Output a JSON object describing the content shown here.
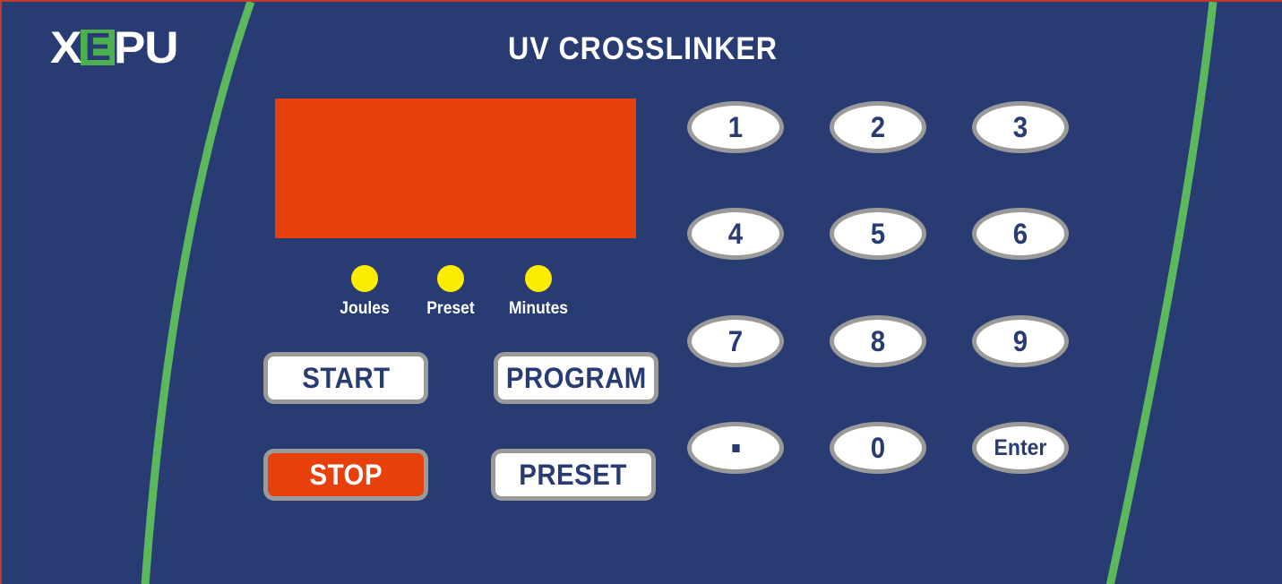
{
  "device": {
    "title": "UV CROSSLINKER",
    "brand": {
      "part1": "X",
      "highlight": "E",
      "part2": "PU"
    },
    "colors": {
      "panel_bg": "#283C73",
      "accent_green": "#4CAF50",
      "display_orange": "#E8400A",
      "led_yellow": "#FBEC00",
      "button_white": "#FFFFFF",
      "button_border_gray": "#9A9A99",
      "text_navy": "#283C73",
      "edge_red": "#C0392B"
    }
  },
  "display": {
    "value": "",
    "name": "display-panel"
  },
  "indicators": [
    {
      "label": "Joules",
      "icon": "led-indicator",
      "lit": true
    },
    {
      "label": "Preset",
      "icon": "led-indicator",
      "lit": true
    },
    {
      "label": "Minutes",
      "icon": "led-indicator",
      "lit": true
    }
  ],
  "action_buttons": [
    {
      "label": "START",
      "style": "light"
    },
    {
      "label": "PROGRAM",
      "style": "light"
    },
    {
      "label": "STOP",
      "style": "danger"
    },
    {
      "label": "PRESET",
      "style": "light"
    }
  ],
  "keypad": [
    {
      "label": "1",
      "kind": "digit"
    },
    {
      "label": "2",
      "kind": "digit"
    },
    {
      "label": "3",
      "kind": "digit"
    },
    {
      "label": "4",
      "kind": "digit"
    },
    {
      "label": "5",
      "kind": "digit"
    },
    {
      "label": "6",
      "kind": "digit"
    },
    {
      "label": "7",
      "kind": "digit"
    },
    {
      "label": "8",
      "kind": "digit"
    },
    {
      "label": "9",
      "kind": "digit"
    },
    {
      "label": ".",
      "kind": "decimal"
    },
    {
      "label": "0",
      "kind": "digit"
    },
    {
      "label": "Enter",
      "kind": "enter"
    }
  ]
}
